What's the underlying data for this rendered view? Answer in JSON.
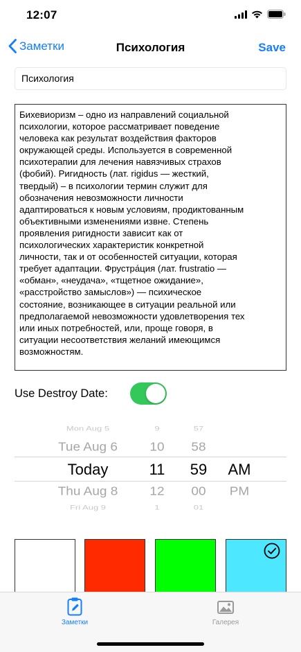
{
  "status_bar": {
    "time": "12:07"
  },
  "nav": {
    "back_label": "Заметки",
    "title": "Психология",
    "save_label": "Save"
  },
  "note": {
    "title_value": "Психология",
    "body": "Бихевиоризм – одно из направлений социальной\nпсихологии, которое рассматривает поведение\nчеловека как результат воздействия факторов\nокружающей среды. Используется в современной\nпсихотерапии для лечения навязчивых страхов\n(фобий). Ригидность (лат. rigidus — жесткий,\nтвердый) – в психологии термин служит для\nобозначения невозможности личности\nадаптироваться к новым условиям, продиктованным\nобъективными изменениями извне. Степень\nпроявления ригидности зависит как от\nпсихологических характеристик конкретной\nличности, так и от особенностей ситуации, которая\nтребует адаптации. Фрустра́ция (лат. frustratio —\n«обман», «неудача», «тщетное ожидание»,\n«расстройство замыслов») — психическое\nсостояние, возникающее в ситуации реальной или\nпредполагаемой невозможности удовлетворения тех\nили иных потребностей, или, проще говоря, в\nситуации несоответствия желаний имеющимся\nвозможностям."
  },
  "destroy": {
    "label": "Use Destroy Date:",
    "enabled": true
  },
  "picker": {
    "date": [
      "Mon Aug 5",
      "Tue Aug 6",
      "Today",
      "Thu Aug 8",
      "Fri Aug 9"
    ],
    "hour": [
      "9",
      "10",
      "11",
      "12",
      "1"
    ],
    "minute": [
      "57",
      "58",
      "59",
      "00",
      "01"
    ],
    "ampm": [
      "",
      "",
      "AM",
      "PM",
      ""
    ]
  },
  "swatches": {
    "colors": [
      "#ffffff",
      "#ff2a00",
      "#00ff00",
      "#4de8ff"
    ],
    "selected_index": 3
  },
  "tabs": {
    "notes_label": "Заметки",
    "gallery_label": "Галерея",
    "active_color": "#147efb"
  }
}
